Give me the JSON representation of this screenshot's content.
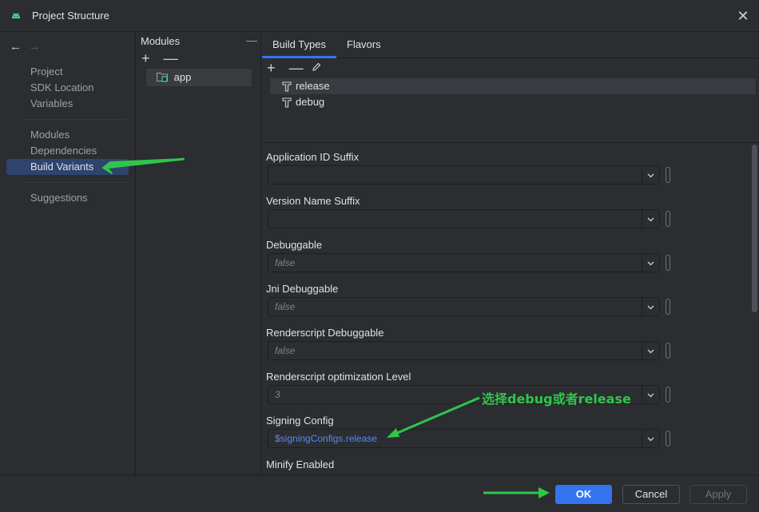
{
  "window": {
    "title": "Project Structure",
    "close_glyph": "✕"
  },
  "nav": {
    "back_glyph": "←",
    "forward_glyph": "→",
    "items": [
      {
        "label": "Project"
      },
      {
        "label": "SDK Location"
      },
      {
        "label": "Variables"
      },
      {
        "label": "Modules"
      },
      {
        "label": "Dependencies"
      },
      {
        "label": "Build Variants",
        "selected": true
      },
      {
        "label": "Suggestions"
      }
    ]
  },
  "modules": {
    "header": "Modules",
    "hide_glyph": "—",
    "add_glyph": "+",
    "remove_glyph": "—",
    "items": [
      {
        "label": "app",
        "selected": true
      }
    ]
  },
  "tabs": [
    {
      "label": "Build Types",
      "active": true
    },
    {
      "label": "Flavors",
      "active": false
    }
  ],
  "build_types": {
    "add_glyph": "+",
    "remove_glyph": "—",
    "items": [
      {
        "label": "release",
        "selected": true
      },
      {
        "label": "debug",
        "selected": false
      }
    ]
  },
  "fields": [
    {
      "label": "Application ID Suffix",
      "value": ""
    },
    {
      "label": "Version Name Suffix",
      "value": ""
    },
    {
      "label": "Debuggable",
      "value": "false"
    },
    {
      "label": "Jni Debuggable",
      "value": "false"
    },
    {
      "label": "Renderscript Debuggable",
      "value": "false"
    },
    {
      "label": "Renderscript optimization Level",
      "value": "3"
    },
    {
      "label": "Signing Config",
      "value": "$signingConfigs.release"
    },
    {
      "label": "Minify Enabled",
      "value": ""
    }
  ],
  "footer": {
    "ok": "OK",
    "cancel": "Cancel",
    "apply": "Apply"
  },
  "annotation": {
    "text": "选择debug或者release",
    "color": "#2fc64a"
  },
  "colors": {
    "accent": "#3574f0",
    "selection": "#2e436e",
    "link": "#548af7"
  }
}
